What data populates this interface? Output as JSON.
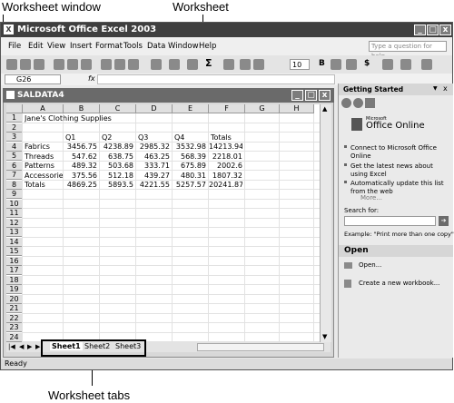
{
  "callouts": {
    "worksheet_window": "Worksheet window",
    "worksheet": "Worksheet",
    "worksheet_tabs": "Worksheet tabs"
  },
  "app": {
    "title": "Microsoft Office Excel 2003",
    "min": "_",
    "max": "▢",
    "close": "x"
  },
  "menu": {
    "items": [
      "File",
      "Edit",
      "View",
      "Insert",
      "Format",
      "Tools",
      "Data",
      "Window",
      "Help"
    ],
    "ask_placeholder": "Type a question for help"
  },
  "toolbar": {
    "font_size": "10",
    "bold": "B",
    "currency": "$"
  },
  "formula": {
    "cell_ref": "G26",
    "fx": "fx"
  },
  "workbook": {
    "title": "SALDATA4",
    "min": "_",
    "max": "▢",
    "close": "x"
  },
  "grid": {
    "columns": [
      "A",
      "B",
      "C",
      "D",
      "E",
      "F",
      "G",
      "H"
    ],
    "rows": [
      [
        "Jane's Clothing Supplies",
        "",
        "",
        "",
        "",
        "",
        "",
        ""
      ],
      [
        "",
        "",
        "",
        "",
        "",
        "",
        "",
        ""
      ],
      [
        "",
        "Q1",
        "Q2",
        "Q3",
        "Q4",
        "Totals",
        "",
        ""
      ],
      [
        "Fabrics",
        "3456.75",
        "4238.89",
        "2985.32",
        "3532.98",
        "14213.94",
        "",
        ""
      ],
      [
        "Threads",
        "547.62",
        "638.75",
        "463.25",
        "568.39",
        "2218.01",
        "",
        ""
      ],
      [
        "Patterns",
        "489.32",
        "503.68",
        "333.71",
        "675.89",
        "2002.6",
        "",
        ""
      ],
      [
        "Accessorie",
        "375.56",
        "512.18",
        "439.27",
        "480.31",
        "1807.32",
        "",
        ""
      ],
      [
        "Totals",
        "4869.25",
        "5893.5",
        "4221.55",
        "5257.57",
        "20241.87",
        "",
        ""
      ]
    ],
    "row_count": 24
  },
  "tabs": {
    "items": [
      "Sheet1",
      "Sheet2",
      "Sheet3"
    ],
    "active": "Sheet1"
  },
  "task_pane": {
    "title": "Getting Started",
    "close": "x",
    "brand_small": "Microsoft",
    "brand": "Office Online",
    "links": [
      "Connect to Microsoft Office Online",
      "Get the latest news about using Excel",
      "Automatically update this list from the web"
    ],
    "more": "More...",
    "search_label": "Search for:",
    "example": "Example: \"Print more than one copy\"",
    "open_header": "Open",
    "open_link": "Open...",
    "new_link": "Create a new workbook..."
  },
  "status": {
    "text": "Ready"
  }
}
